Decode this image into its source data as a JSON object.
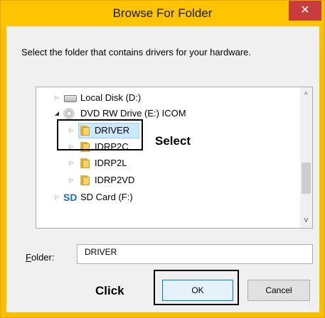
{
  "window": {
    "title": "Browse For Folder",
    "close_glyph": "✕"
  },
  "description": "Select the folder that contains drivers for your hardware.",
  "tree": {
    "items": [
      {
        "label": "Local Disk (D:)",
        "icon": "hard-disk-icon",
        "expanded": false
      },
      {
        "label": "DVD RW Drive (E:) ICOM",
        "icon": "dvd-drive-icon",
        "expanded": true
      },
      {
        "label": "DRIVER",
        "icon": "folder-icon",
        "expanded": false,
        "selected": true
      },
      {
        "label": "IDRP2C",
        "icon": "folder-icon",
        "expanded": false
      },
      {
        "label": "IDRP2L",
        "icon": "folder-icon",
        "expanded": false
      },
      {
        "label": "IDRP2VD",
        "icon": "folder-icon",
        "expanded": false
      },
      {
        "label": "SD Card (F:)",
        "icon": "sd-card-icon",
        "expanded": false
      }
    ],
    "collapsed_glyph": "▷",
    "expanded_glyph": "◢",
    "scroll_up_glyph": "^",
    "scroll_down_glyph": "v"
  },
  "annotations": {
    "select_label": "Select",
    "click_label": "Click"
  },
  "folder_field": {
    "label_underlined": "F",
    "label_rest": "older:",
    "value": "DRIVER"
  },
  "buttons": {
    "ok": "OK",
    "cancel": "Cancel"
  },
  "colors": {
    "frame": "#ffc400",
    "close": "#c83c3c",
    "selection": "#cce8ff"
  }
}
